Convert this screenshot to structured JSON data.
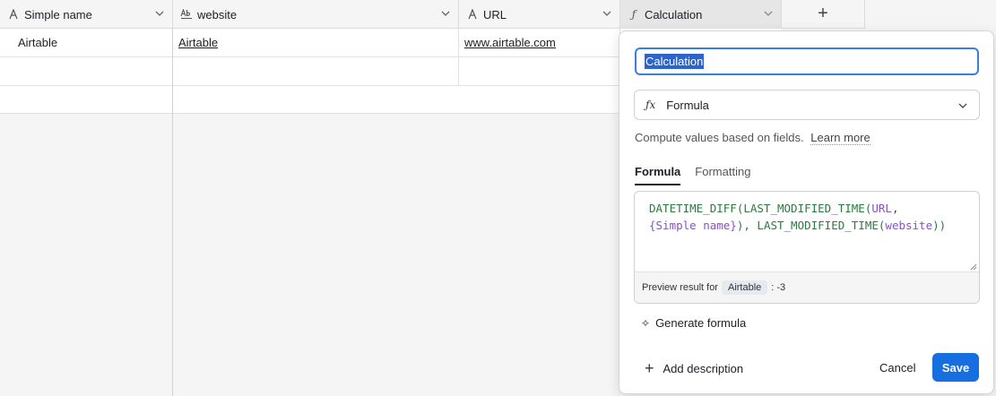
{
  "columns": [
    {
      "label": "Simple name",
      "icon": "text-icon"
    },
    {
      "label": "website",
      "icon": "long-text-icon"
    },
    {
      "label": "URL",
      "icon": "text-icon"
    },
    {
      "label": "Calculation",
      "icon": "formula-icon"
    }
  ],
  "add_column_label": "+",
  "rows": [
    {
      "simple_name": "Airtable",
      "website": "Airtable",
      "url": "www.airtable.com"
    }
  ],
  "panel": {
    "field_name": "Calculation",
    "field_type": "Formula",
    "description": "Compute values based on fields.",
    "learn_more": "Learn more",
    "tabs": [
      "Formula",
      "Formatting"
    ],
    "formula_parts": {
      "l1a": "DATETIME_DIFF(LAST_MODIFIED_TIME(",
      "l1b": "URL",
      "l1c": ",",
      "l2a": "{Simple name}",
      "l2b": "), LAST_MODIFIED_TIME(",
      "l2c": "website",
      "l2d": "))"
    },
    "preview_label": "Preview result for",
    "preview_record": "Airtable",
    "preview_value": ": -3",
    "generate_formula": "Generate formula",
    "add_description": "Add description",
    "cancel": "Cancel",
    "save": "Save"
  },
  "colors": {
    "accent": "#166ee1",
    "selection": "#2b63cf",
    "formula_fn": "#2c7a3f",
    "formula_field": "#8a4ecf"
  }
}
